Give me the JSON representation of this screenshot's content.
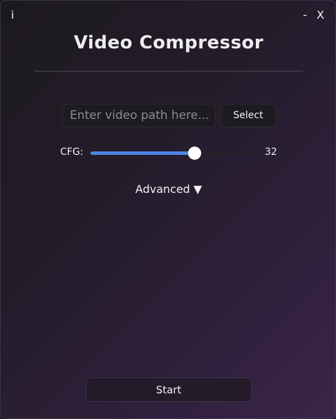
{
  "window": {
    "info_label": "i",
    "minimize_label": "-",
    "close_label": "X"
  },
  "header": {
    "title": "Video Compressor"
  },
  "input": {
    "path_value": "",
    "path_placeholder": "Enter video path here...",
    "select_label": "Select"
  },
  "cfg": {
    "label": "CFG:",
    "value": "32",
    "min": 0,
    "max": 51,
    "fill_fraction": 0.62
  },
  "advanced": {
    "label": "Advanced",
    "arrow": "▼"
  },
  "footer": {
    "start_label": "Start"
  },
  "colors": {
    "accent": "#4f84e6",
    "background_start": "#1c1a1e",
    "background_end": "#3c2449"
  }
}
